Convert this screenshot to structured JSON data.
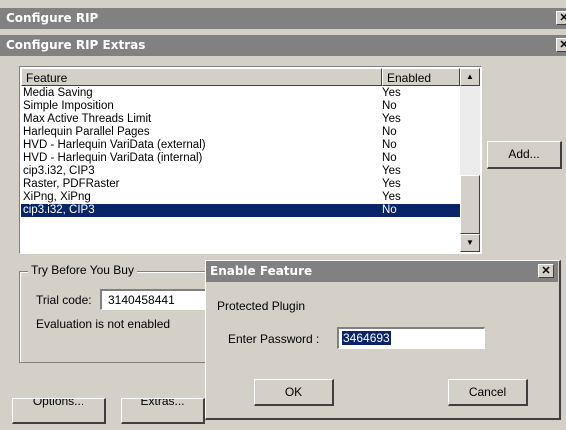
{
  "window1": {
    "title": "Configure RIP"
  },
  "window2": {
    "title": "Configure RIP Extras"
  },
  "table": {
    "headers": [
      "Feature",
      "Enabled"
    ],
    "rows": [
      {
        "feature": "Media Saving",
        "enabled": "Yes"
      },
      {
        "feature": "Simple Imposition",
        "enabled": "No"
      },
      {
        "feature": "Max Active Threads Limit",
        "enabled": "Yes"
      },
      {
        "feature": "Harlequin Parallel Pages",
        "enabled": "No"
      },
      {
        "feature": "HVD  - Harlequin VariData (external)",
        "enabled": "No"
      },
      {
        "feature": "HVD  - Harlequin VariData (internal)",
        "enabled": "No"
      },
      {
        "feature": "cip3.i32, CIP3",
        "enabled": "Yes"
      },
      {
        "feature": "Raster, PDFRaster",
        "enabled": "Yes"
      },
      {
        "feature": "XiPng, XiPng",
        "enabled": "Yes"
      },
      {
        "feature": "cip3.i32, CIP3",
        "enabled": "No",
        "selected": true
      }
    ]
  },
  "buttons": {
    "add": "Add...",
    "options": "Options...",
    "extras": "Extras..."
  },
  "trial": {
    "group_title": "Try Before You Buy",
    "code_label": "Trial code:",
    "code_value": "3140458441",
    "status": "Evaluation is not enabled"
  },
  "dialog": {
    "title": "Enable Feature",
    "subtitle": "Protected Plugin",
    "password_label": "Enter Password :",
    "password_value": "3464693",
    "ok": "OK",
    "cancel": "Cancel"
  },
  "colors": {
    "titlebar": "#818181",
    "selection": "#0a246a",
    "face": "#d4d0c8"
  },
  "icons": {
    "close": "close-icon",
    "scroll_up": "scroll-up-arrow-icon",
    "scroll_down": "scroll-down-arrow-icon"
  }
}
